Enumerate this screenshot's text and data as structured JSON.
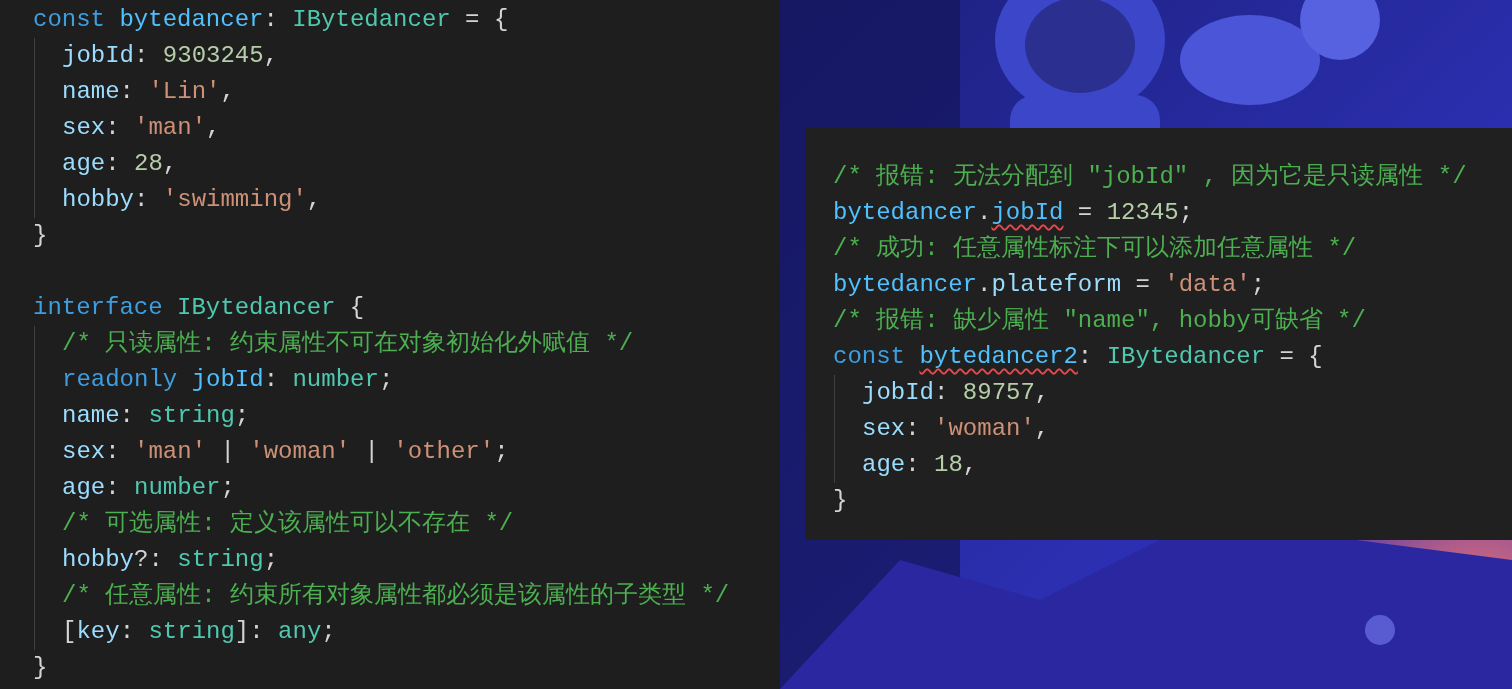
{
  "left_editor": {
    "lines": [
      {
        "tokens": [
          {
            "kind": "keyword",
            "text": "const "
          },
          {
            "kind": "variable",
            "text": "bytedancer"
          },
          {
            "kind": "plain",
            "text": ": "
          },
          {
            "kind": "type",
            "text": "IBytedancer"
          },
          {
            "kind": "plain",
            "text": " = {"
          }
        ],
        "children": [
          {
            "tokens": [
              {
                "kind": "property",
                "text": "jobId"
              },
              {
                "kind": "plain",
                "text": ": "
              },
              {
                "kind": "number",
                "text": "9303245"
              },
              {
                "kind": "plain",
                "text": ","
              }
            ]
          },
          {
            "tokens": [
              {
                "kind": "property",
                "text": "name"
              },
              {
                "kind": "plain",
                "text": ": "
              },
              {
                "kind": "string",
                "text": "'Lin'"
              },
              {
                "kind": "plain",
                "text": ","
              }
            ]
          },
          {
            "tokens": [
              {
                "kind": "property",
                "text": "sex"
              },
              {
                "kind": "plain",
                "text": ": "
              },
              {
                "kind": "string",
                "text": "'man'"
              },
              {
                "kind": "plain",
                "text": ","
              }
            ]
          },
          {
            "tokens": [
              {
                "kind": "property",
                "text": "age"
              },
              {
                "kind": "plain",
                "text": ": "
              },
              {
                "kind": "number",
                "text": "28"
              },
              {
                "kind": "plain",
                "text": ","
              }
            ]
          },
          {
            "tokens": [
              {
                "kind": "property",
                "text": "hobby"
              },
              {
                "kind": "plain",
                "text": ": "
              },
              {
                "kind": "string",
                "text": "'swimming'"
              },
              {
                "kind": "plain",
                "text": ","
              }
            ]
          }
        ]
      },
      {
        "tokens": [
          {
            "kind": "plain",
            "text": "}"
          }
        ]
      },
      {
        "blank_line_before": true,
        "tokens": [
          {
            "kind": "keyword",
            "text": "interface "
          },
          {
            "kind": "type",
            "text": "IBytedancer"
          },
          {
            "kind": "plain",
            "text": " {"
          }
        ],
        "children": [
          {
            "tokens": [
              {
                "kind": "comment",
                "text": "/* 只读属性: 约束属性不可在对象初始化外赋值 */"
              }
            ]
          },
          {
            "tokens": [
              {
                "kind": "keyword",
                "text": "readonly "
              },
              {
                "kind": "variable",
                "text": "jobId"
              },
              {
                "kind": "plain",
                "text": ": "
              },
              {
                "kind": "type",
                "text": "number"
              },
              {
                "kind": "plain",
                "text": ";"
              }
            ]
          },
          {
            "tokens": [
              {
                "kind": "property",
                "text": "name"
              },
              {
                "kind": "plain",
                "text": ": "
              },
              {
                "kind": "type",
                "text": "string"
              },
              {
                "kind": "plain",
                "text": ";"
              }
            ]
          },
          {
            "tokens": [
              {
                "kind": "property",
                "text": "sex"
              },
              {
                "kind": "plain",
                "text": ": "
              },
              {
                "kind": "string",
                "text": "'man'"
              },
              {
                "kind": "plain",
                "text": " | "
              },
              {
                "kind": "string",
                "text": "'woman'"
              },
              {
                "kind": "plain",
                "text": " | "
              },
              {
                "kind": "string",
                "text": "'other'"
              },
              {
                "kind": "plain",
                "text": ";"
              }
            ]
          },
          {
            "tokens": [
              {
                "kind": "property",
                "text": "age"
              },
              {
                "kind": "plain",
                "text": ": "
              },
              {
                "kind": "type",
                "text": "number"
              },
              {
                "kind": "plain",
                "text": ";"
              }
            ]
          },
          {
            "tokens": [
              {
                "kind": "comment",
                "text": "/* 可选属性: 定义该属性可以不存在 */"
              }
            ]
          },
          {
            "tokens": [
              {
                "kind": "property",
                "text": "hobby"
              },
              {
                "kind": "plain",
                "text": "?: "
              },
              {
                "kind": "type",
                "text": "string"
              },
              {
                "kind": "plain",
                "text": ";"
              }
            ]
          },
          {
            "tokens": [
              {
                "kind": "comment",
                "text": "/* 任意属性: 约束所有对象属性都必须是该属性的子类型 */"
              }
            ]
          },
          {
            "tokens": [
              {
                "kind": "plain",
                "text": "["
              },
              {
                "kind": "property",
                "text": "key"
              },
              {
                "kind": "plain",
                "text": ": "
              },
              {
                "kind": "type",
                "text": "string"
              },
              {
                "kind": "plain",
                "text": "]: "
              },
              {
                "kind": "type",
                "text": "any"
              },
              {
                "kind": "plain",
                "text": ";"
              }
            ]
          }
        ]
      },
      {
        "tokens": [
          {
            "kind": "plain",
            "text": "}"
          }
        ]
      }
    ]
  },
  "right_editor": {
    "lines": [
      {
        "tokens": [
          {
            "kind": "comment",
            "text": "/* 报错: 无法分配到 \"jobId\" , 因为它是只读属性 */"
          }
        ]
      },
      {
        "tokens": [
          {
            "kind": "variable",
            "text": "bytedancer"
          },
          {
            "kind": "plain",
            "text": "."
          },
          {
            "kind": "variable",
            "text": "jobId",
            "error": true
          },
          {
            "kind": "plain",
            "text": " = "
          },
          {
            "kind": "number",
            "text": "12345"
          },
          {
            "kind": "plain",
            "text": ";"
          }
        ]
      },
      {
        "tokens": [
          {
            "kind": "comment",
            "text": "/* 成功: 任意属性标注下可以添加任意属性 */"
          }
        ]
      },
      {
        "tokens": [
          {
            "kind": "variable",
            "text": "bytedancer"
          },
          {
            "kind": "plain",
            "text": "."
          },
          {
            "kind": "property",
            "text": "plateform"
          },
          {
            "kind": "plain",
            "text": " = "
          },
          {
            "kind": "string",
            "text": "'data'"
          },
          {
            "kind": "plain",
            "text": ";"
          }
        ]
      },
      {
        "tokens": [
          {
            "kind": "comment",
            "text": "/* 报错: 缺少属性 \"name\", hobby可缺省 */"
          }
        ]
      },
      {
        "tokens": [
          {
            "kind": "keyword",
            "text": "const "
          },
          {
            "kind": "variable",
            "text": "bytedancer2",
            "error": true
          },
          {
            "kind": "plain",
            "text": ": "
          },
          {
            "kind": "type",
            "text": "IBytedancer"
          },
          {
            "kind": "plain",
            "text": " = {"
          }
        ],
        "children": [
          {
            "tokens": [
              {
                "kind": "property",
                "text": "jobId"
              },
              {
                "kind": "plain",
                "text": ": "
              },
              {
                "kind": "number",
                "text": "89757"
              },
              {
                "kind": "plain",
                "text": ","
              }
            ]
          },
          {
            "tokens": [
              {
                "kind": "property",
                "text": "sex"
              },
              {
                "kind": "plain",
                "text": ": "
              },
              {
                "kind": "string",
                "text": "'woman'"
              },
              {
                "kind": "plain",
                "text": ","
              }
            ]
          },
          {
            "tokens": [
              {
                "kind": "property",
                "text": "age"
              },
              {
                "kind": "plain",
                "text": ": "
              },
              {
                "kind": "number",
                "text": "18"
              },
              {
                "kind": "plain",
                "text": ","
              }
            ]
          }
        ]
      },
      {
        "tokens": [
          {
            "kind": "plain",
            "text": "}"
          }
        ]
      }
    ]
  }
}
